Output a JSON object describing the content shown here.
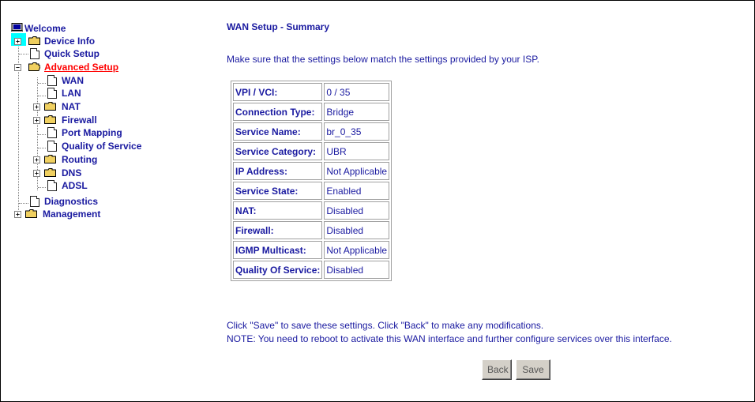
{
  "sidebar": {
    "items": [
      {
        "label": "Welcome"
      },
      {
        "label": "Device Info"
      },
      {
        "label": "Quick Setup"
      },
      {
        "label": "Advanced Setup"
      },
      {
        "label": "WAN"
      },
      {
        "label": "LAN"
      },
      {
        "label": "NAT"
      },
      {
        "label": "Firewall"
      },
      {
        "label": "Port Mapping"
      },
      {
        "label": "Quality of Service"
      },
      {
        "label": "Routing"
      },
      {
        "label": "DNS"
      },
      {
        "label": "ADSL"
      },
      {
        "label": "Diagnostics"
      },
      {
        "label": "Management"
      }
    ],
    "active_item": "Advanced Setup",
    "active_color": "#ff0000"
  },
  "main": {
    "title": "WAN Setup - Summary",
    "intro": "Make sure that the settings below match the settings provided by your ISP.",
    "summary_rows": [
      {
        "key": "VPI / VCI:",
        "value": "0 / 35"
      },
      {
        "key": "Connection Type:",
        "value": "Bridge"
      },
      {
        "key": "Service Name:",
        "value": "br_0_35"
      },
      {
        "key": "Service Category:",
        "value": "UBR"
      },
      {
        "key": "IP Address:",
        "value": "Not Applicable"
      },
      {
        "key": "Service State:",
        "value": "Enabled"
      },
      {
        "key": "NAT:",
        "value": "Disabled"
      },
      {
        "key": "Firewall:",
        "value": "Disabled"
      },
      {
        "key": "IGMP Multicast:",
        "value": "Not Applicable"
      },
      {
        "key": "Quality Of Service:",
        "value": "Disabled"
      }
    ],
    "note_line1": "Click \"Save\" to save these settings. Click \"Back\" to make any modifications.",
    "note_line2": "NOTE: You need to reboot to activate this WAN interface and further configure services over this interface.",
    "back_label": "Back",
    "save_label": "Save"
  },
  "colors": {
    "text": "#1a1aa0",
    "highlight": "#00ffff",
    "folder": "#f0d060",
    "button_bg": "#d4d0c8"
  }
}
